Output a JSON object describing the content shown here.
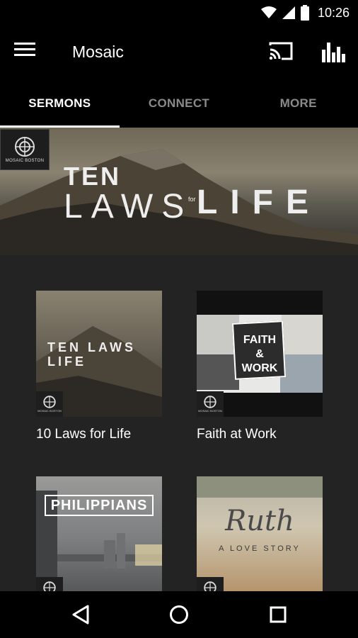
{
  "status_bar": {
    "time": "10:26",
    "icons": [
      "wifi-icon",
      "cell-signal-icon",
      "battery-icon"
    ]
  },
  "app_bar": {
    "title": "Mosaic",
    "icons": [
      "menu-icon",
      "cast-icon",
      "bar-chart-icon"
    ]
  },
  "tabs": [
    {
      "label": "SERMONS",
      "active": true
    },
    {
      "label": "CONNECT",
      "active": false
    },
    {
      "label": "MORE",
      "active": false
    }
  ],
  "hero": {
    "logo_text": "MOSAIC BOSTON",
    "title_line1": "TEN",
    "title_part1": "LAWS",
    "title_connector": "for",
    "title_part2": "LIFE"
  },
  "series": [
    {
      "label": "10 Laws for Life",
      "art_text": "TEN LAWS LIFE"
    },
    {
      "label": "Faith at Work",
      "art_text": "FAITH & WORK"
    },
    {
      "label": "",
      "art_text": "PHILIPPIANS"
    },
    {
      "label": "",
      "art_text": "Ruth",
      "art_subtext": "A LOVE STORY"
    }
  ],
  "colors": {
    "background": "#000000",
    "content_background": "#232323",
    "tab_inactive": "#8a8a8a",
    "tab_active": "#ffffff"
  }
}
